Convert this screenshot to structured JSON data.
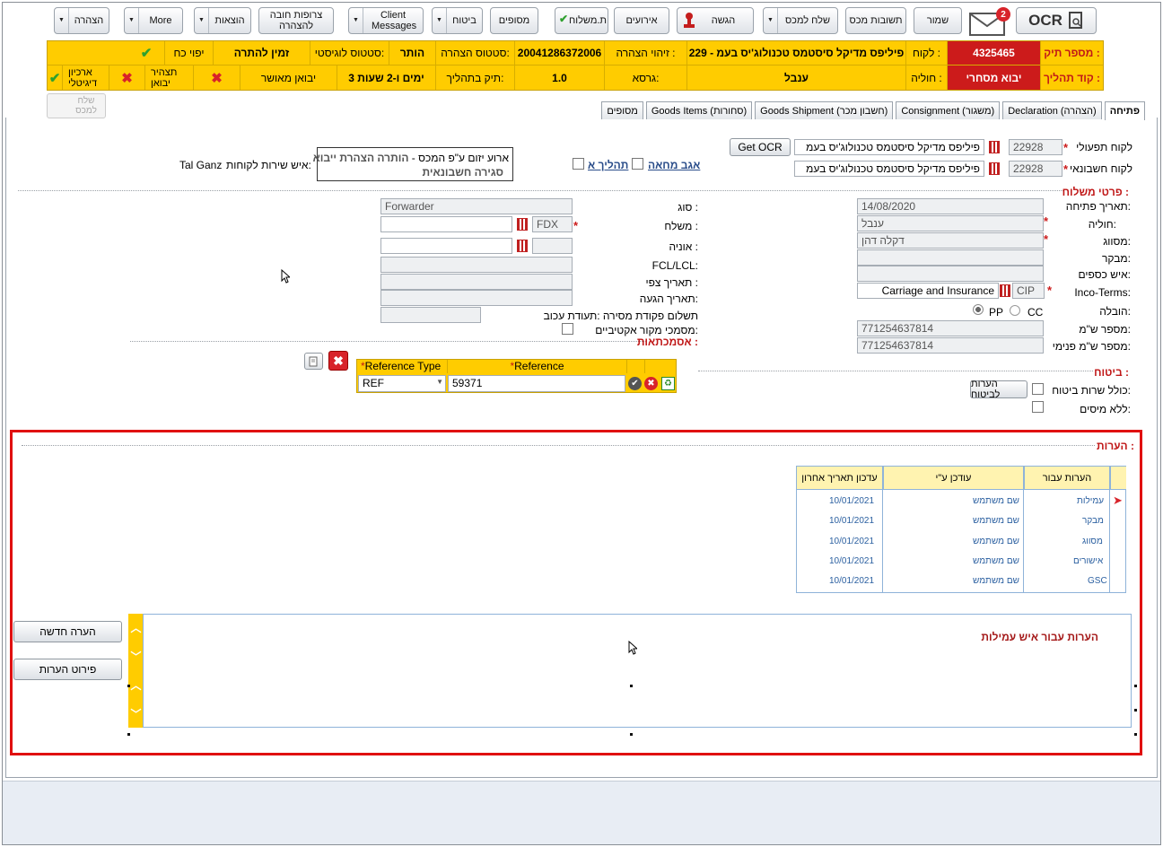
{
  "toolbar": {
    "ocr_label": "OCR",
    "mail_badge": "2",
    "save": "שמור",
    "customs_responses": "תשובות מכס",
    "send_to_customs": "שלח למכס",
    "submission": "הגשה",
    "events": "אירועים",
    "t_shipper": "ת.משלוח",
    "extras": "מסופים",
    "insurance": "ביטוח",
    "client_messages": "Client Messages",
    "required_attachments": "צרופות חובה להצהרה",
    "expenses": "הוצאות",
    "more": "More",
    "declaration": "הצהרה",
    "send_to_customs_disabled": "שלח למכס"
  },
  "info": {
    "file_no_label": "מספר תיק :",
    "file_no": "4325465",
    "client_label": "לקוח :",
    "client": "פיליפס מדיקל סיסטמס טכנולוג'יס בעמ - 229",
    "decl_id_label": "זיהוי הצהרה :",
    "decl_id": "20041286372006",
    "decl_status_label": "סטטוס הצהרה:",
    "decl_status": "הותר",
    "log_status_label": "סטטוס לוגיסטי:",
    "log_status": "זמין להתרה",
    "poa_label": "יפוי כח",
    "process_label": "קוד תהליך :",
    "process": "יבוא מסחרי",
    "shipment_label": "חוליה :",
    "shipment": "ענבל",
    "gross_label": "גרסא:",
    "gross": "1.0",
    "in_process_label": "תיק בתהליך:",
    "in_process": "3 ימים ו-2 שעות",
    "import_approved": "יבואן מאושר",
    "import_decl": "תצהיר יבואן",
    "digital_archive": "ארכיון דיגיטלי"
  },
  "tabs": [
    "פתיחה",
    "Declaration (הצהרה)",
    "Consignment (משגור)",
    "Goods Shipment (חשבון מכר)",
    "Goods Items (סחורות)",
    "מסופים"
  ],
  "form": {
    "operational_client_label": "לקוח תפעולי",
    "operational_client_code": "22928",
    "operational_client_name": "פיליפס מדיקל סיסטמס טכנולוג'יס בעמ",
    "billing_client_label": "לקוח חשבונאי",
    "billing_client_code": "22928",
    "billing_client_name": "פיליפס מדיקל סיסטמס טכנולוג'יס בעמ",
    "get_ocr": "Get OCR",
    "agent_protest": "אגב מחאה",
    "process_a": "תהליך א",
    "event_label": "ארוע יזום ע\"פ המכס -",
    "event_value": "הותרה הצהרת ייבוא",
    "event_value2": "סגירה חשבונאית",
    "cs_label": "איש שירות לקוחות:",
    "cs_value": "Tal Ganz",
    "shipment_section": "פרטי משלוח :",
    "open_date_label": "תאריך פתיחה:",
    "open_date": "14/08/2020",
    "chain_label": "חוליה:",
    "chain": "ענבל",
    "classified_label": "מסווג:",
    "classified": "דקלה דהן",
    "inspector_label": "מבקר:",
    "finance_label": "איש כספים:",
    "incoterms_label": "Inco-Terms:",
    "incoterms_code": "CIP",
    "incoterms_name": "Carriage and Insurance",
    "freight_label": "הובלה:",
    "pp": "PP",
    "cc": "CC",
    "awb_label": "מספר ש\"מ:",
    "awb": "771254637814",
    "awb_internal_label": "מספר ש\"מ פנימי:",
    "awb_internal": "771254637814",
    "type_label": "סוג :",
    "type": "Forwarder",
    "shipper_label": "משלח :",
    "shipper_code": "FDX",
    "ship_label": "אוניה :",
    "fcl_label": "FCL/LCL:",
    "eta_label": "תאריך צפי :",
    "arrival_label": "תאריך הגעה:",
    "payment_label": "תשלום פקודת מסירה :תעודת עכוב",
    "active_docs_label": "מסמכי מקור אקטיביים:",
    "references_section": "אסמכתאות :",
    "ref_type_header": "Reference Type",
    "ref_header": "Reference",
    "ref_type_value": "REF",
    "ref_value": "59371",
    "insurance_section": "ביטוח :",
    "insurance_included_label": "כולל שרות ביטוח:",
    "insurance_notes_btn": "הערות לביטוח",
    "no_taxes_label": "ללא מיסים:"
  },
  "notes": {
    "section": "הערות :",
    "col_for": "הערות עבור",
    "col_by": "עודכן ע\"י",
    "col_date": "עדכון תאריך אחרון",
    "rows": [
      {
        "for": "עמילות",
        "by": "שם משתמש",
        "date": "10/01/2021"
      },
      {
        "for": "מבקר",
        "by": "שם משתמש",
        "date": "10/01/2021"
      },
      {
        "for": "מסווג",
        "by": "שם משתמש",
        "date": "10/01/2021"
      },
      {
        "for": "אישורים",
        "by": "שם משתמש",
        "date": "10/01/2021"
      },
      {
        "for": "GSC",
        "by": "שם משתמש",
        "date": "10/01/2021"
      }
    ],
    "box_title": "הערות עבור איש עמילות",
    "new_note": "הערה חדשה",
    "notes_detail": "פירוט הערות"
  }
}
